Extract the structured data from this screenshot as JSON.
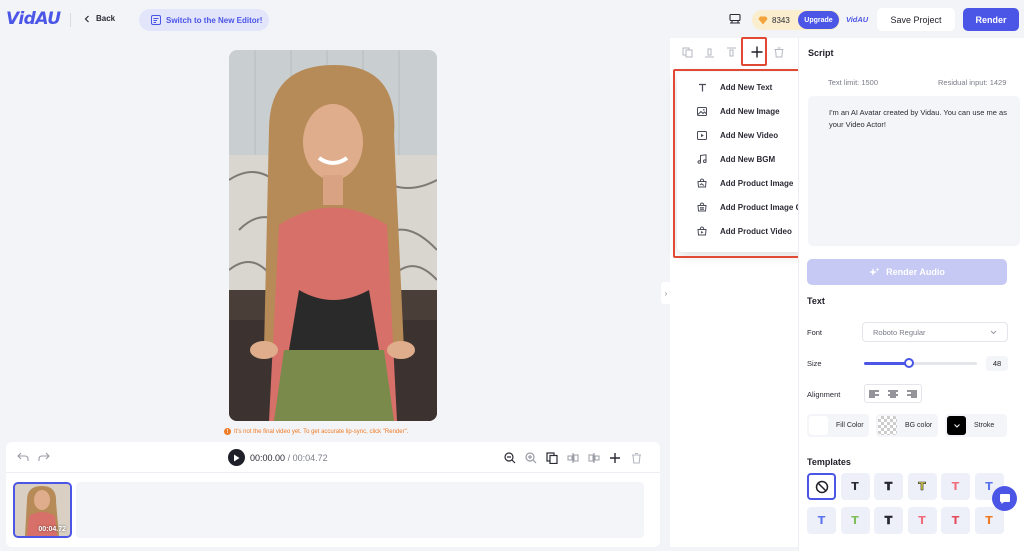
{
  "header": {
    "logo": "VidAU",
    "back_label": "Back",
    "switch_label": "Switch to the New Editor!",
    "credits": "8343",
    "upgrade_label": "Upgrade",
    "badge": "VidAU",
    "save_label": "Save Project",
    "render_label": "Render"
  },
  "preview": {
    "notice": "It's not the final video yet. To get accurate lip-sync, click \"Render\"."
  },
  "timeline": {
    "current_time": "00:00.00",
    "separator": "/",
    "total_time": "00:04.72",
    "clip_duration": "00:04.72"
  },
  "add_menu": {
    "items": [
      {
        "label": "Add New Text",
        "icon": "text-icon"
      },
      {
        "label": "Add New Image",
        "icon": "image-icon"
      },
      {
        "label": "Add New Video",
        "icon": "video-icon"
      },
      {
        "label": "Add New BGM",
        "icon": "music-icon"
      },
      {
        "label": "Add Product Image",
        "icon": "product-image-icon"
      },
      {
        "label": "Add Product Image Group",
        "icon": "product-image-group-icon"
      },
      {
        "label": "Add Product Video",
        "icon": "product-video-icon"
      }
    ]
  },
  "script": {
    "title": "Script",
    "text_limit": "Text limit: 1500",
    "residual": "Residual input: 1429",
    "text": "I'm an AI Avatar created by Vidau. You can use me as your Video Actor!",
    "render_audio_label": "Render Audio"
  },
  "text_settings": {
    "section_title": "Text",
    "font_label": "Font",
    "font_value": "Roboto Regular",
    "size_label": "Size",
    "size_value": "48",
    "size_fraction": 0.4,
    "alignment_label": "Alignment",
    "fill_color_label": "Fill Color",
    "bg_color_label": "BG color",
    "stroke_label": "Stroke"
  },
  "templates": {
    "title": "Templates",
    "items": [
      {
        "glyph": "",
        "color": "#1f1f29",
        "kind": "none"
      },
      {
        "glyph": "T",
        "color": "#2a2a35"
      },
      {
        "glyph": "T",
        "color": "#2a2a35"
      },
      {
        "glyph": "T",
        "color": "#e3d84a"
      },
      {
        "glyph": "T",
        "color": "#f06e7c"
      },
      {
        "glyph": "T",
        "color": "#5a74f0"
      },
      {
        "glyph": "T",
        "color": "#5a74f0"
      },
      {
        "glyph": "T",
        "color": "#7fbf5a"
      },
      {
        "glyph": "T",
        "color": "#2a2a35"
      },
      {
        "glyph": "T",
        "color": "#f06e7c"
      },
      {
        "glyph": "T",
        "color": "#e34b5c"
      },
      {
        "glyph": "T",
        "color": "#ee7a25"
      }
    ]
  },
  "colors": {
    "accent": "#4b55e6",
    "highlight": "#e04a34",
    "warning": "#ee7a25"
  }
}
